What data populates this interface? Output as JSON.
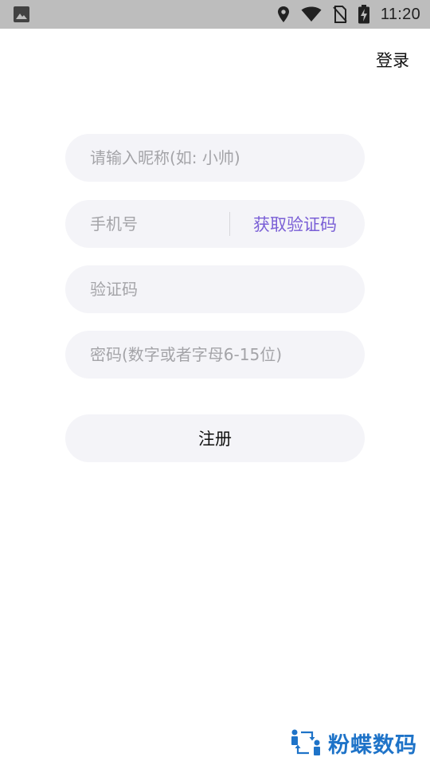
{
  "status_bar": {
    "time": "11:20",
    "icons": [
      "image-icon",
      "location-icon",
      "wifi-icon",
      "no-sim-icon",
      "battery-charging-icon"
    ]
  },
  "header": {
    "login_label": "登录"
  },
  "form": {
    "nickname_placeholder": "请输入昵称(如: 小帅)",
    "phone_placeholder": "手机号",
    "get_code_label": "获取验证码",
    "code_placeholder": "验证码",
    "password_placeholder": "密码(数字或者字母6-15位)",
    "register_label": "注册"
  },
  "watermark": {
    "text": "粉蝶数码"
  },
  "colors": {
    "accent": "#7a5fd6",
    "field_bg": "#f4f4f8",
    "placeholder": "#a4a4a8",
    "status_bar": "#bdbdbd",
    "watermark": "#1e73c8"
  }
}
